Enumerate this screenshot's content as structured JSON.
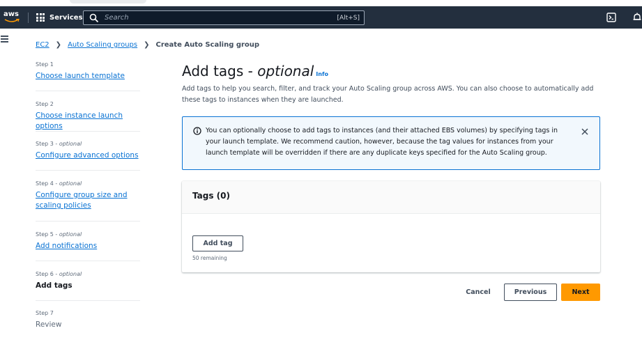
{
  "nav": {
    "logo_text": "aws",
    "services_label": "Services",
    "search_placeholder": "Search",
    "search_shortcut": "[Alt+S]",
    "icons": [
      "cloudshell-icon",
      "notifications-icon"
    ]
  },
  "breadcrumb": {
    "items": [
      "EC2",
      "Auto Scaling groups"
    ],
    "current": "Create Auto Scaling group"
  },
  "steps": [
    {
      "number": "Step 1",
      "optional": "",
      "label": "Choose launch template",
      "state": "link"
    },
    {
      "number": "Step 2",
      "optional": "",
      "label": "Choose instance launch options",
      "state": "link"
    },
    {
      "number": "Step 3 - ",
      "optional": "optional",
      "label": "Configure advanced options",
      "state": "link"
    },
    {
      "number": "Step 4 - ",
      "optional": "optional",
      "label": "Configure group size and scaling policies",
      "state": "link"
    },
    {
      "number": "Step 5 - ",
      "optional": "optional",
      "label": "Add notifications",
      "state": "link"
    },
    {
      "number": "Step 6 - ",
      "optional": "optional",
      "label": "Add tags",
      "state": "active"
    },
    {
      "number": "Step 7",
      "optional": "",
      "label": "Review",
      "state": "disabled"
    }
  ],
  "page": {
    "title": "Add tags - ",
    "title_optional": "optional",
    "info_link": "Info",
    "description": "Add tags to help you search, filter, and track your Auto Scaling group across AWS. You can also choose to automatically add these tags to instances when they are launched."
  },
  "alert": {
    "text": "You can optionally choose to add tags to instances (and their attached EBS volumes) by specifying tags in your launch template. We recommend caution, however, because the tag values for instances from your launch template will be overridden if there are any duplicate keys specified for the Auto Scaling group."
  },
  "tags": {
    "header": "Tags (0)",
    "add_button": "Add tag",
    "remaining": "50 remaining"
  },
  "footer": {
    "cancel": "Cancel",
    "previous": "Previous",
    "next": "Next"
  },
  "colors": {
    "navbar": "#232f3e",
    "link": "#0972d3",
    "primary_button": "#ff9900",
    "info_alert_bg": "#f2f8fd"
  }
}
